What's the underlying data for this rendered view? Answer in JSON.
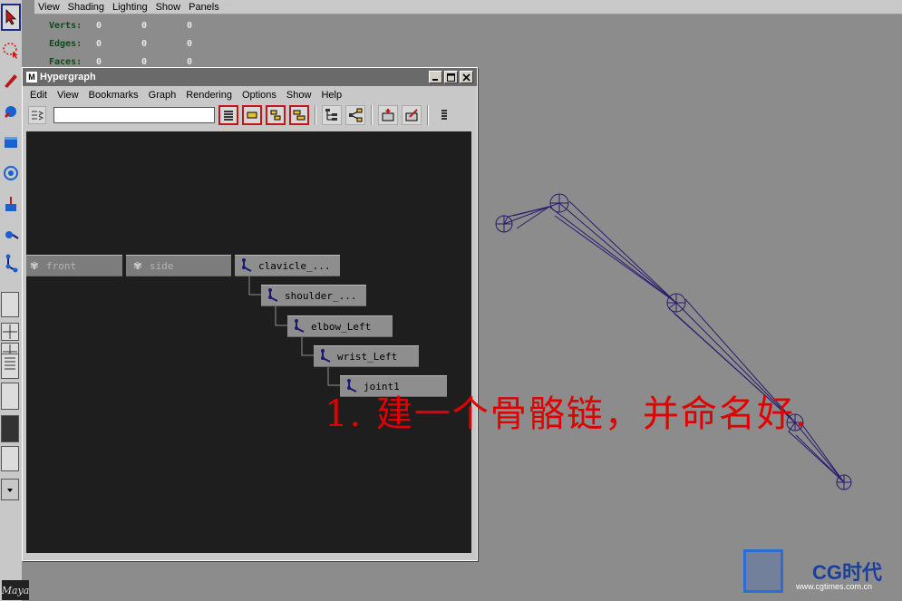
{
  "viewport": {
    "menu": [
      "View",
      "Shading",
      "Lighting",
      "Show",
      "Panels"
    ],
    "hud": [
      {
        "label": "Verts:",
        "values": [
          "0",
          "0",
          "0"
        ]
      },
      {
        "label": "Edges:",
        "values": [
          "0",
          "0",
          "0"
        ]
      },
      {
        "label": "Faces:",
        "values": [
          "0",
          "0",
          "0"
        ]
      }
    ],
    "annotation": "1. 建一个骨骼链，并命名好.",
    "annotation_color": "#e00000",
    "joint_color": "#2a1a6e"
  },
  "toolbox": {
    "logo": "Maya",
    "tools": [
      "select-tool-icon",
      "lasso-tool-icon",
      "paint-select-icon",
      "move-tool-icon",
      "rotate-tool-icon",
      "scale-tool-icon",
      "manipulator-icon",
      "joint-tool-icon"
    ]
  },
  "hypergraph": {
    "title": "Hypergraph",
    "menu": [
      "Edit",
      "View",
      "Bookmarks",
      "Graph",
      "Rendering",
      "Options",
      "Show",
      "Help"
    ],
    "search_value": "",
    "nodes": [
      {
        "label": "front",
        "kind": "camera"
      },
      {
        "label": "side",
        "kind": "camera"
      },
      {
        "label": "clavicle_...",
        "kind": "joint"
      },
      {
        "label": "shoulder_...",
        "kind": "joint"
      },
      {
        "label": "elbow_Left",
        "kind": "joint"
      },
      {
        "label": "wrist_Left",
        "kind": "joint"
      },
      {
        "label": "joint1",
        "kind": "joint"
      }
    ]
  },
  "watermark": {
    "brand": "CG时代",
    "url": "www.cgtimes.com.cn"
  }
}
